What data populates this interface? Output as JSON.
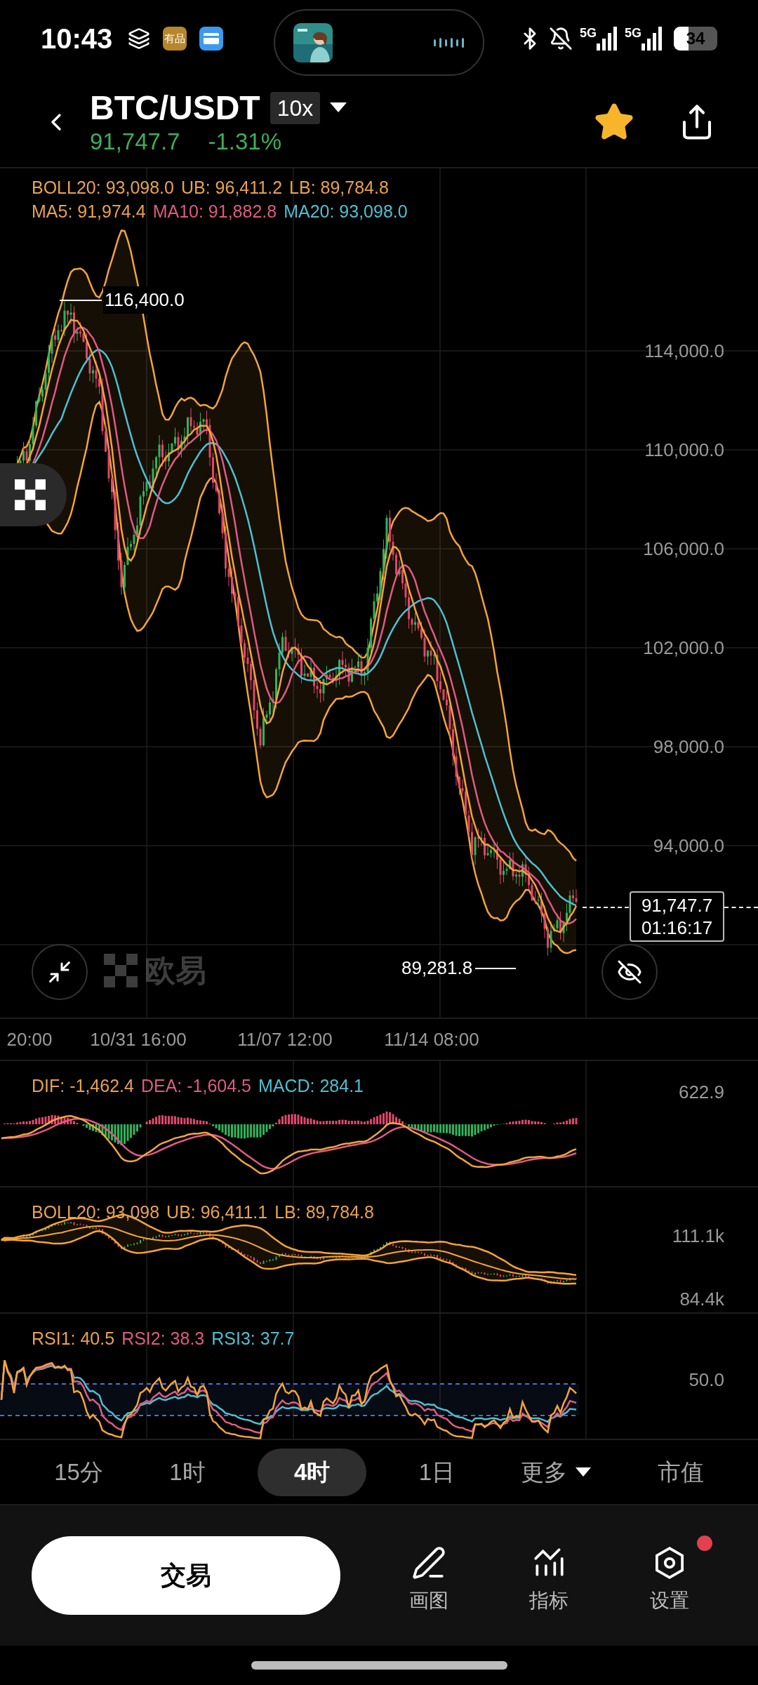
{
  "status_bar": {
    "time": "10:43",
    "app_badge": "有品",
    "network_1": "5G",
    "network_2": "5G",
    "battery": "34"
  },
  "header": {
    "symbol": "BTC/USDT",
    "leverage": "10x",
    "price": "91,747.7",
    "change": "-1.31%",
    "favorite": true
  },
  "main_chart": {
    "legend_rows": [
      [
        {
          "text": "BOLL20: 93,098.0",
          "color": "#e9a24d"
        },
        {
          "text": "UB: 96,411.2",
          "color": "#e9a24d"
        },
        {
          "text": "LB: 89,784.8",
          "color": "#e9a24d"
        }
      ],
      [
        {
          "text": "MA5: 91,974.4",
          "color": "#e9a24d"
        },
        {
          "text": "MA10: 91,882.8",
          "color": "#de5a84"
        },
        {
          "text": "MA20: 93,098.0",
          "color": "#4cc0d2"
        }
      ]
    ],
    "high_label": "116,400.0",
    "low_label": "89,281.8",
    "y_labels": [
      "114,000.0",
      "110,000.0",
      "106,000.0",
      "102,000.0",
      "98,000.0",
      "94,000.0"
    ],
    "last_price": "91,747.7",
    "countdown": "01:16:17",
    "watermark": "欧易"
  },
  "x_labels": [
    "20:00",
    "10/31 16:00",
    "11/07 12:00",
    "11/14 08:00"
  ],
  "macd_panel": {
    "legend": [
      {
        "text": "DIF: -1,462.4",
        "color": "#e9a24d"
      },
      {
        "text": "DEA: -1,604.5",
        "color": "#de5a84"
      },
      {
        "text": "MACD: 284.1",
        "color": "#4cc0d2"
      }
    ],
    "y_label": "622.9"
  },
  "boll_panel": {
    "legend": [
      {
        "text": "BOLL20: 93,098",
        "color": "#e9a24d"
      },
      {
        "text": "UB: 96,411.1",
        "color": "#e9a24d"
      },
      {
        "text": "LB: 89,784.8",
        "color": "#e9a24d"
      }
    ],
    "y_labels": [
      "111.1k",
      "84.4k"
    ]
  },
  "rsi_panel": {
    "legend": [
      {
        "text": "RSI1: 40.5",
        "color": "#e9a24d"
      },
      {
        "text": "RSI2: 38.3",
        "color": "#de5a84"
      },
      {
        "text": "RSI3: 37.7",
        "color": "#4cc0d2"
      }
    ],
    "y_label": "50.0"
  },
  "timeframes": [
    {
      "label": "15分",
      "selected": false,
      "kind": "plain"
    },
    {
      "label": "1时",
      "selected": false,
      "kind": "plain"
    },
    {
      "label": "4时",
      "selected": true,
      "kind": "plain"
    },
    {
      "label": "1日",
      "selected": false,
      "kind": "plain"
    },
    {
      "label": "更多",
      "selected": false,
      "kind": "dropdown"
    },
    {
      "label": "市值",
      "selected": false,
      "kind": "plain"
    }
  ],
  "actions": {
    "trade": "交易",
    "tools": [
      {
        "label": "画图",
        "kind": "draw",
        "badge": false
      },
      {
        "label": "指标",
        "kind": "indicator",
        "badge": false
      },
      {
        "label": "设置",
        "kind": "settings",
        "badge": true
      }
    ]
  }
}
